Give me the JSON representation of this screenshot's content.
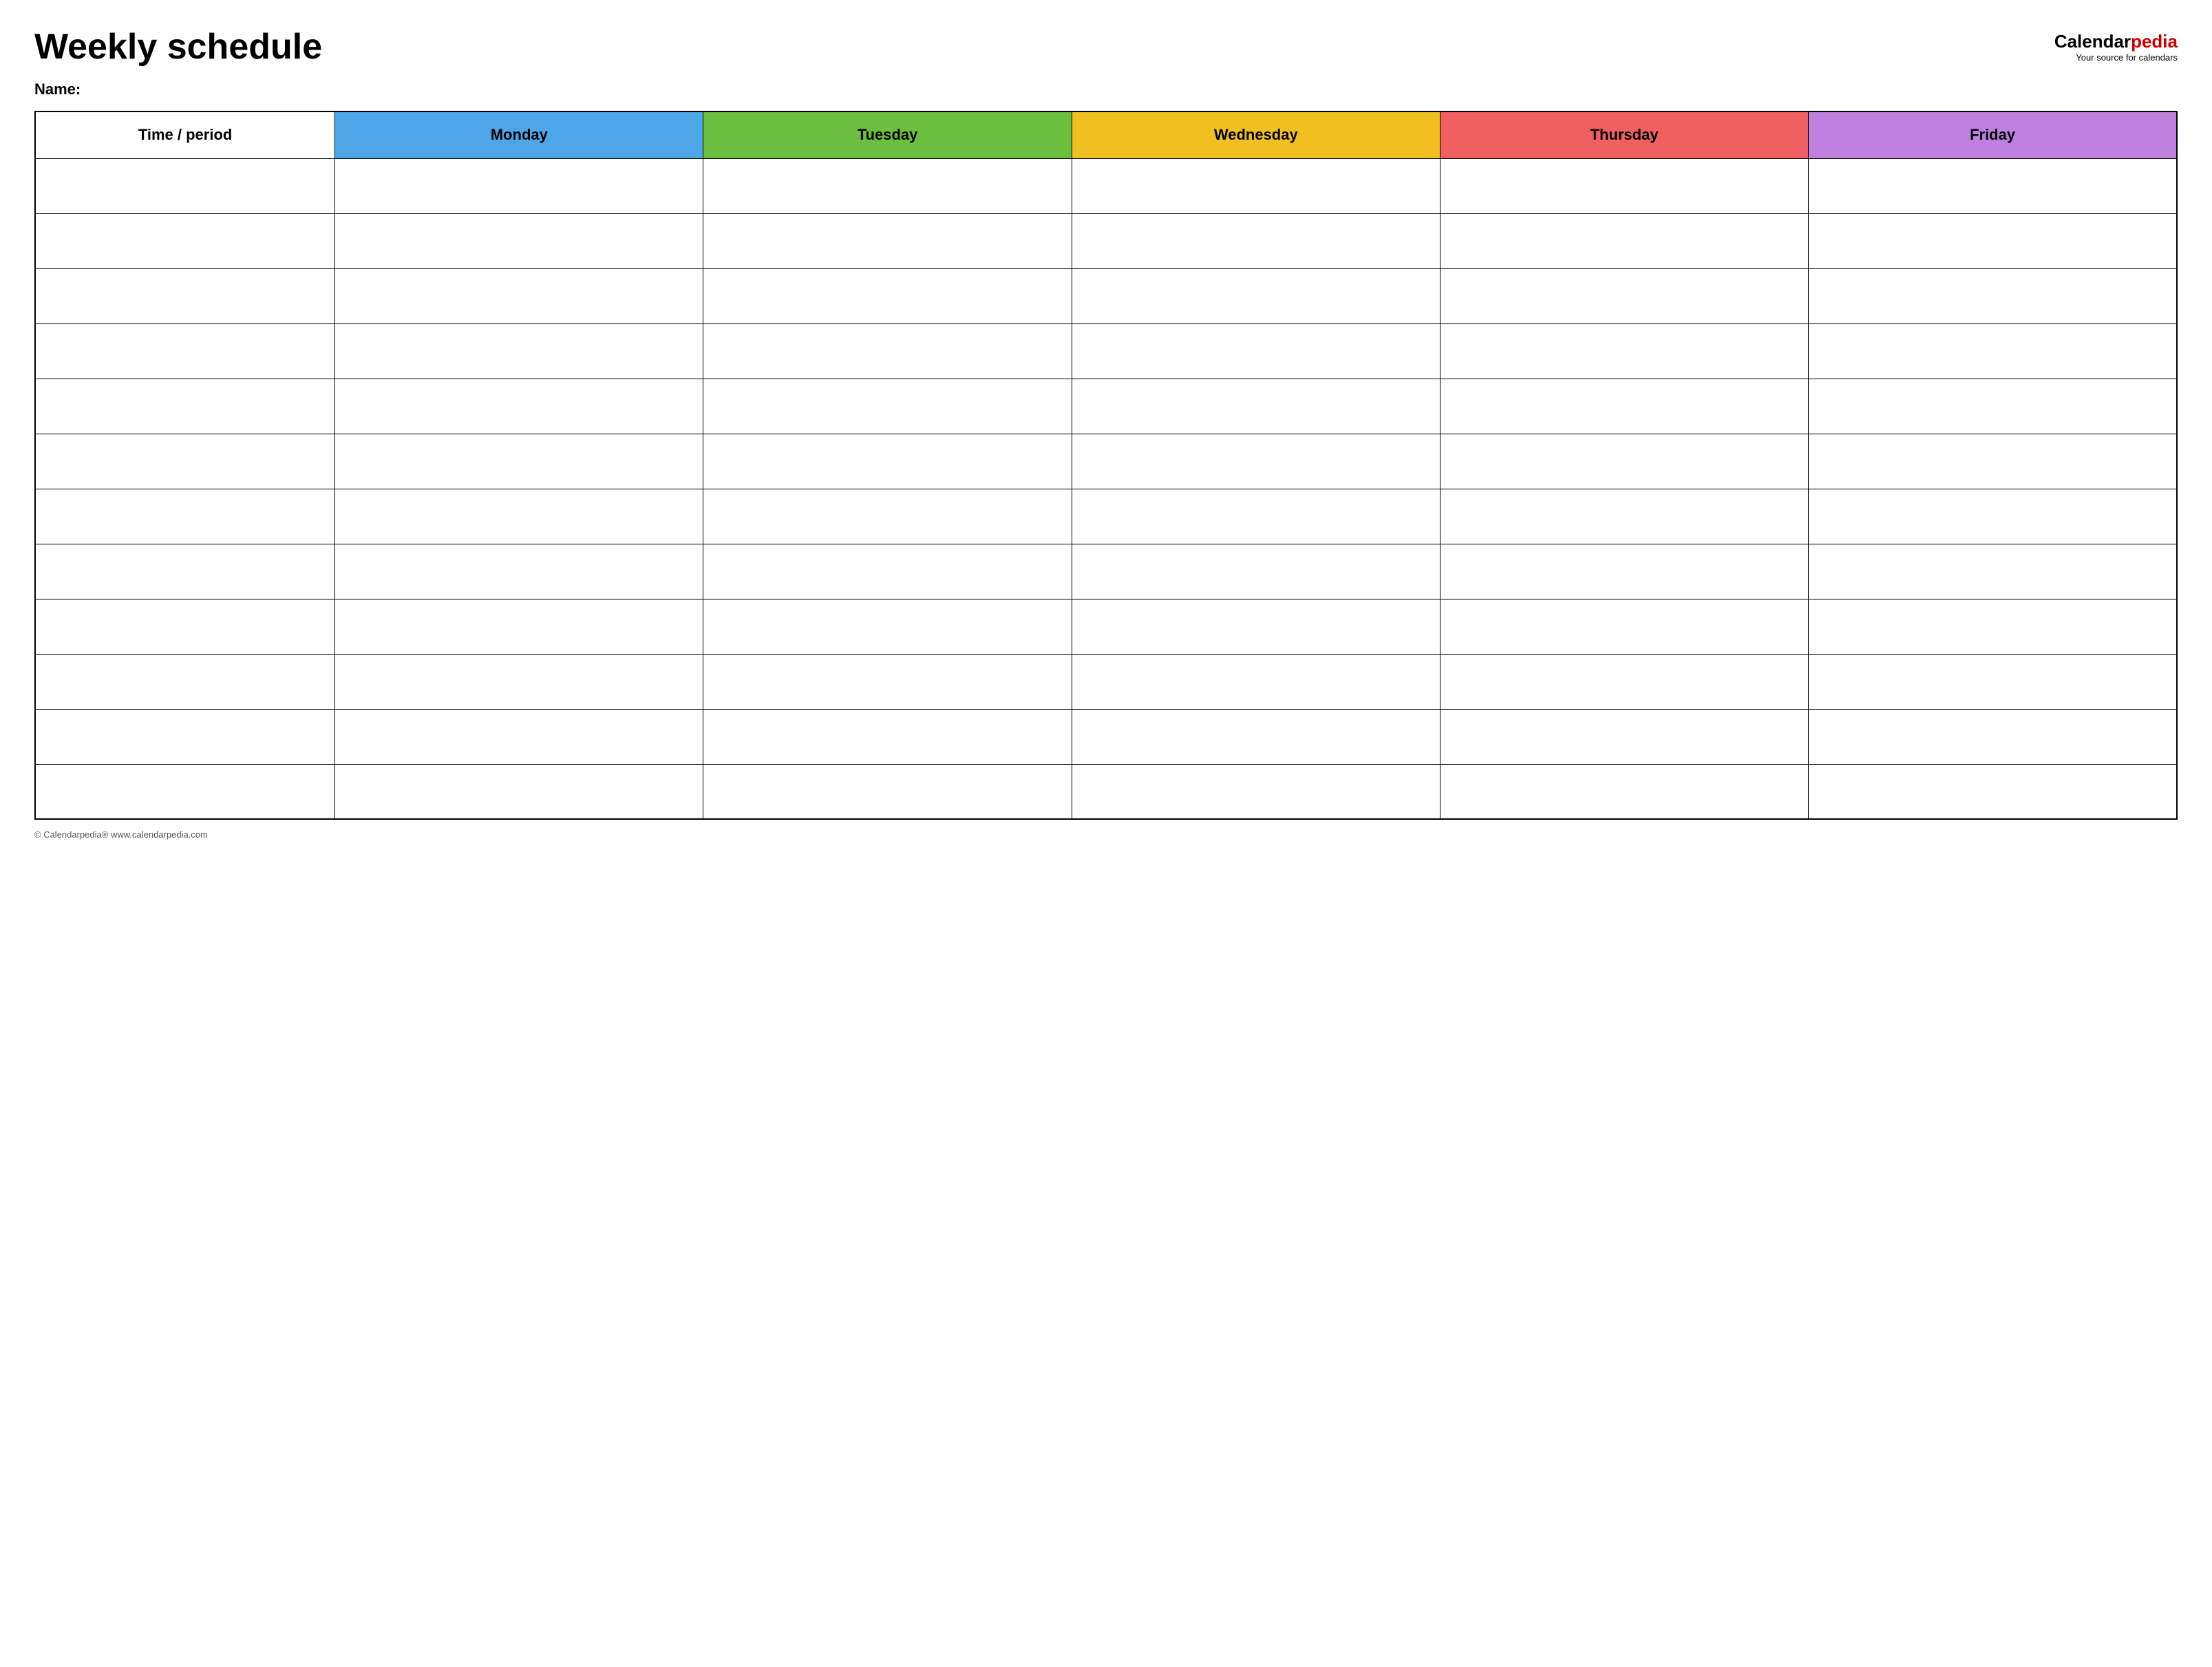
{
  "header": {
    "title": "Weekly schedule",
    "logo": {
      "calendar": "Calendar",
      "pedia": "pedia",
      "tagline": "Your source for calendars"
    }
  },
  "name_label": "Name:",
  "table": {
    "columns": [
      {
        "id": "time",
        "label": "Time / period",
        "color_class": "th-time"
      },
      {
        "id": "monday",
        "label": "Monday",
        "color_class": "th-monday"
      },
      {
        "id": "tuesday",
        "label": "Tuesday",
        "color_class": "th-tuesday"
      },
      {
        "id": "wednesday",
        "label": "Wednesday",
        "color_class": "th-wednesday"
      },
      {
        "id": "thursday",
        "label": "Thursday",
        "color_class": "th-thursday"
      },
      {
        "id": "friday",
        "label": "Friday",
        "color_class": "th-friday"
      }
    ],
    "row_count": 12
  },
  "footer": {
    "text": "© Calendarpedia®  www.calendarpedia.com"
  }
}
